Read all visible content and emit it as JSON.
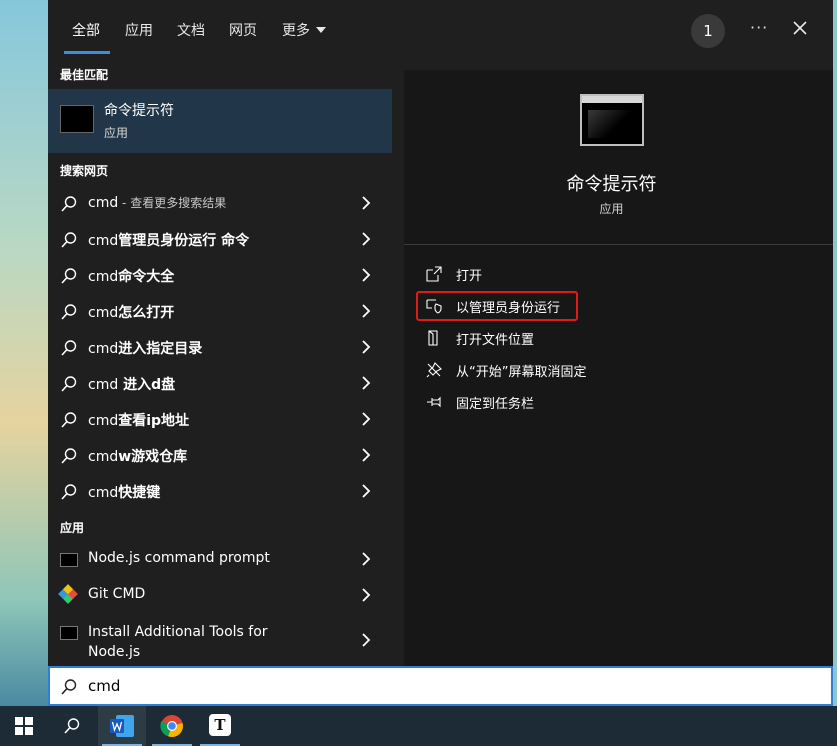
{
  "nav": {
    "tabs": [
      "全部",
      "应用",
      "文档",
      "网页",
      "更多"
    ],
    "badge": "1"
  },
  "best_match": {
    "section": "最佳匹配",
    "name": "命令提示符",
    "type": "应用"
  },
  "web": {
    "section": "搜索网页",
    "items": [
      {
        "prefix": "cmd",
        "rest": "",
        "hint": " - 查看更多搜索结果"
      },
      {
        "prefix": "cmd",
        "rest": "管理员身份运行 命令",
        "hint": ""
      },
      {
        "prefix": "cmd",
        "rest": "命令大全",
        "hint": ""
      },
      {
        "prefix": "cmd",
        "rest": "怎么打开",
        "hint": ""
      },
      {
        "prefix": "cmd",
        "rest": "进入指定目录",
        "hint": ""
      },
      {
        "prefix": "cmd",
        "rest": " 进入d盘",
        "hint": ""
      },
      {
        "prefix": "cmd",
        "rest": "查看ip地址",
        "hint": ""
      },
      {
        "prefix": "cmd",
        "rest": "w游戏仓库",
        "hint": ""
      },
      {
        "prefix": "cmd",
        "rest": "快捷键",
        "hint": ""
      }
    ]
  },
  "apps": {
    "section": "应用",
    "items": [
      {
        "label": "Node.js command prompt",
        "icon": "terminal-icon"
      },
      {
        "label": "Git CMD",
        "icon": "git-icon"
      },
      {
        "label": "Install Additional Tools for",
        "label2": "Node.js",
        "icon": "terminal-icon"
      }
    ]
  },
  "detail": {
    "title": "命令提示符",
    "subtitle": "应用",
    "actions": [
      {
        "label": "打开",
        "icon": "open-icon"
      },
      {
        "label": "以管理员身份运行",
        "icon": "shield-icon"
      },
      {
        "label": "打开文件位置",
        "icon": "folder-icon"
      },
      {
        "label": "从“开始”屏幕取消固定",
        "icon": "unpin-icon"
      },
      {
        "label": "固定到任务栏",
        "icon": "pin-icon"
      }
    ],
    "highlight_color": "#e0191b"
  },
  "search": {
    "value": "cmd"
  },
  "taskbar": {
    "items": [
      "windows-start-icon",
      "search-icon",
      "word-icon",
      "chrome-icon",
      "typora-icon"
    ],
    "typora_letter": "T"
  },
  "colors": {
    "accent": "#3b8fe0",
    "selected_bg": "#213648"
  }
}
